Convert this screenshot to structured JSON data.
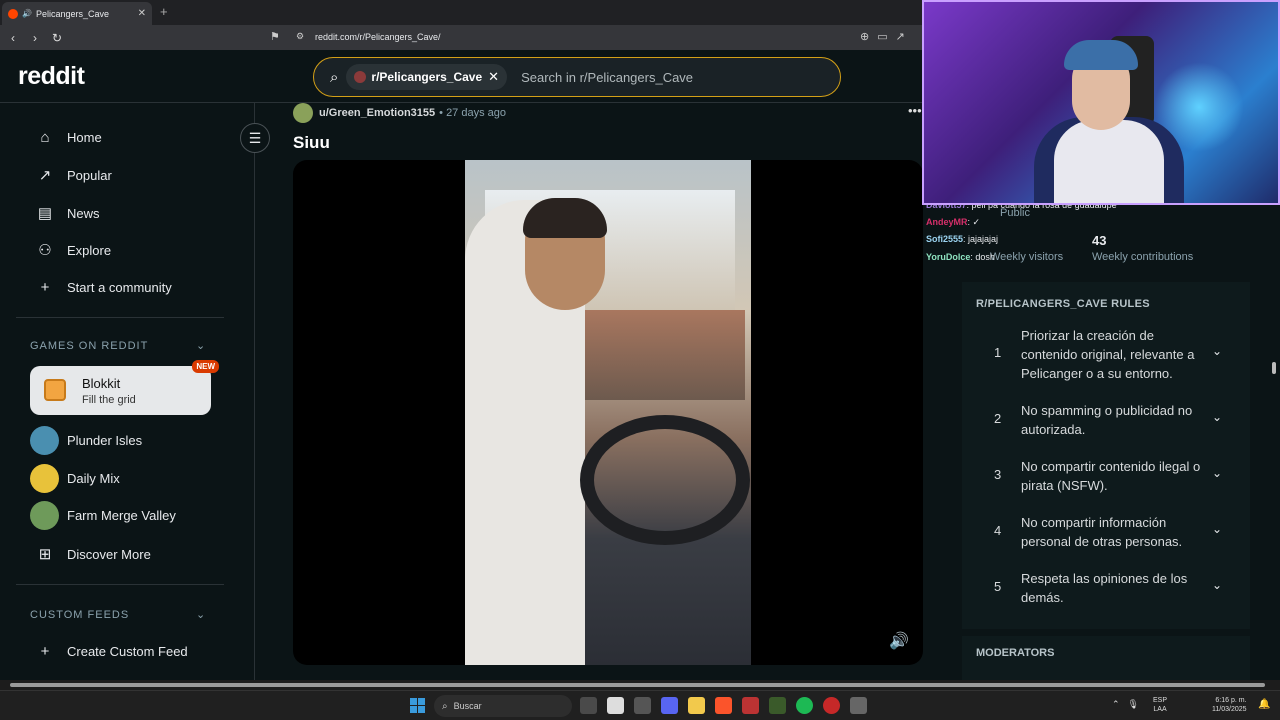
{
  "browser": {
    "tab_title": "Pelicangers_Cave",
    "url": "reddit.com/r/Pelicangers_Cave/"
  },
  "header": {
    "logo": "reddit",
    "search_chip": "r/Pelicangers_Cave",
    "search_placeholder": "Search in r/Pelicangers_Cave"
  },
  "sidebar": {
    "nav": [
      {
        "label": "Home",
        "icon": "home-icon"
      },
      {
        "label": "Popular",
        "icon": "popular-icon"
      },
      {
        "label": "News",
        "icon": "news-icon"
      },
      {
        "label": "Explore",
        "icon": "explore-icon"
      },
      {
        "label": "Start a community",
        "icon": "plus-icon"
      }
    ],
    "games_title": "GAMES ON REDDIT",
    "blokkit": {
      "title": "Blokkit",
      "subtitle": "Fill the grid",
      "badge": "NEW"
    },
    "games": [
      "Plunder Isles",
      "Daily Mix",
      "Farm Merge Valley",
      "Discover More"
    ],
    "feeds_title": "CUSTOM FEEDS",
    "create_feed": "Create Custom Feed"
  },
  "post": {
    "user": "u/Green_Emotion3155",
    "time": "• 27 days ago",
    "title": "Siuu"
  },
  "chat": [
    {
      "name": "Daviott57",
      "msg": ": peli pa cuando la rosa de guadalupe"
    },
    {
      "name": "AndeyMR",
      "msg": ": ✓"
    },
    {
      "name": "Sofi2555",
      "msg": ": jajajajaj"
    },
    {
      "name": "YoruDolce",
      "msg": ": dosh"
    }
  ],
  "community": {
    "public_label": "Public",
    "contributions_value": "43",
    "visitors_label": "Weekly visitors",
    "contributions_label": "Weekly contributions"
  },
  "rules": {
    "title": "R/PELICANGERS_CAVE RULES",
    "items": [
      {
        "num": "1",
        "text": "Priorizar la creación de contenido original, relevante a Pelicanger o a su entorno."
      },
      {
        "num": "2",
        "text": "No spamming o publicidad no autorizada."
      },
      {
        "num": "3",
        "text": "No compartir contenido ilegal o pirata (NSFW)."
      },
      {
        "num": "4",
        "text": "No compartir información personal de otras personas."
      },
      {
        "num": "5",
        "text": "Respeta las opiniones de los demás."
      }
    ]
  },
  "moderators_title": "MODERATORS",
  "taskbar": {
    "search": "Buscar",
    "lang1": "ESP",
    "lang2": "LAA",
    "time": "6:16 p. m.",
    "date": "11/03/2025"
  }
}
